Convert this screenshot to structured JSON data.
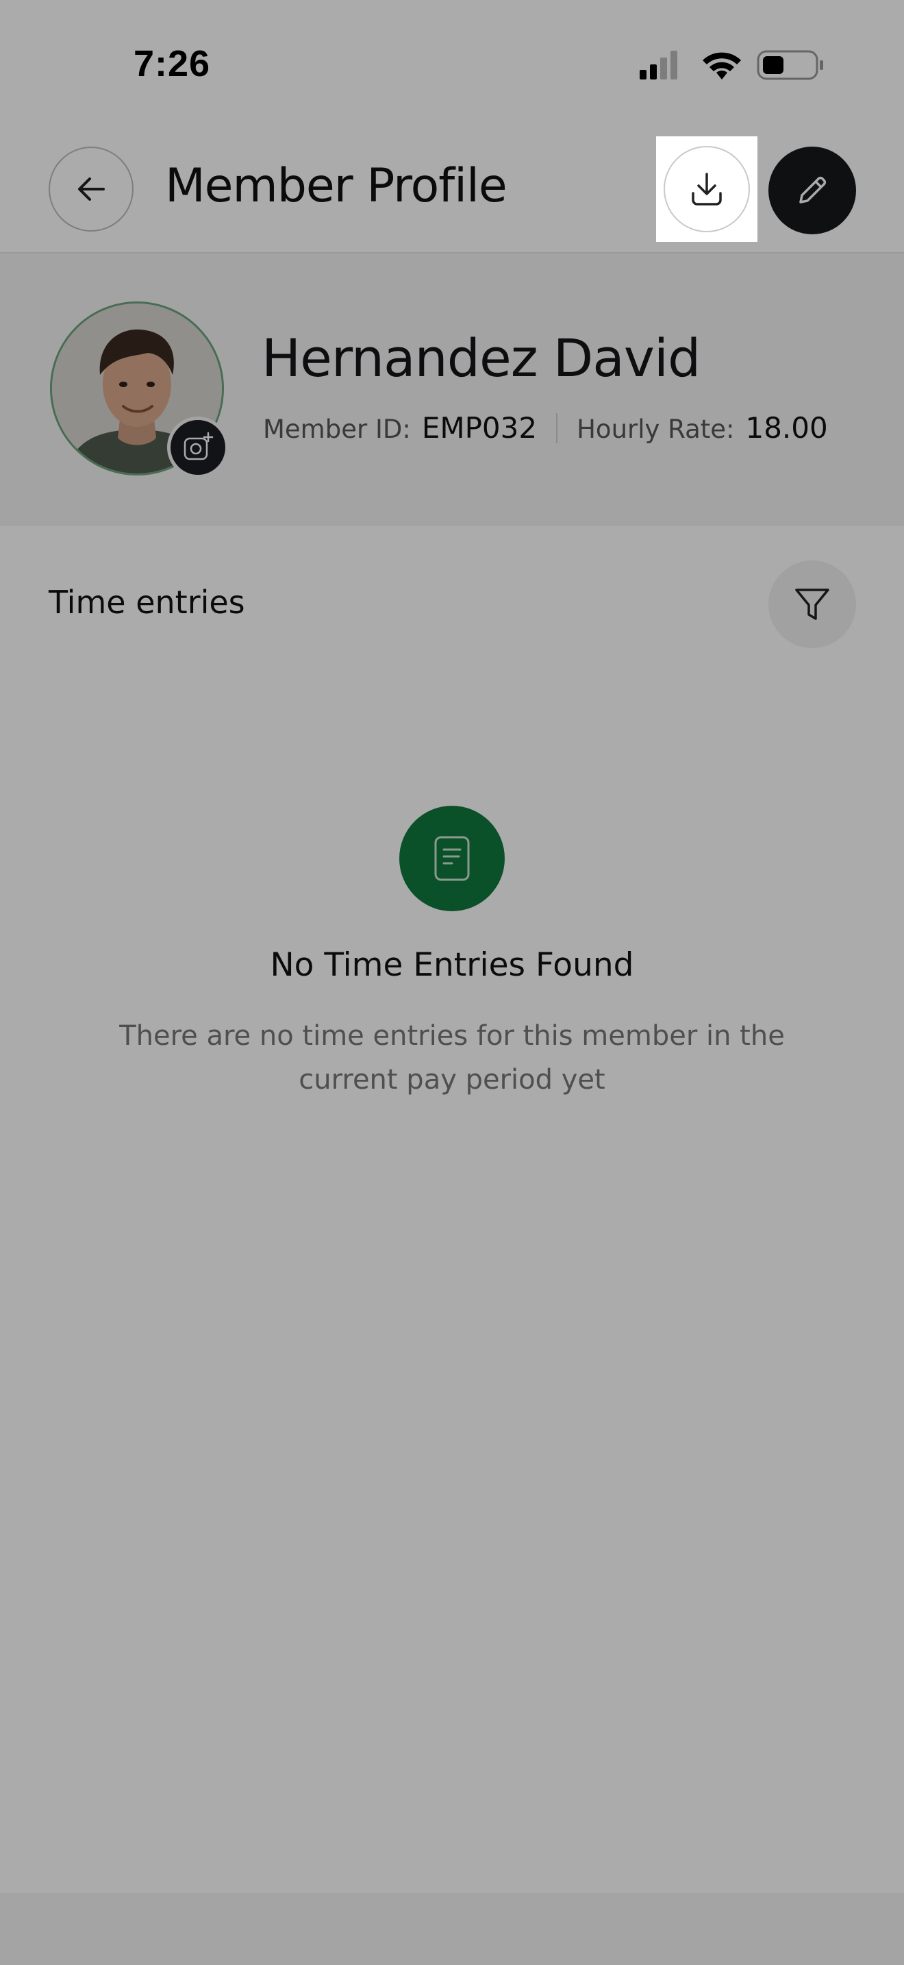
{
  "status_bar": {
    "time": "7:26",
    "signal_icon": "cellular-signal-icon",
    "wifi_icon": "wifi-icon",
    "battery_icon": "battery-icon"
  },
  "header": {
    "title": "Member Profile",
    "back_icon": "arrow-left-icon",
    "download_icon": "download-icon",
    "edit_icon": "pencil-icon"
  },
  "profile": {
    "name": "Hernandez David",
    "member_id_label": "Member ID:",
    "member_id": "EMP032",
    "hourly_rate_label": "Hourly Rate:",
    "hourly_rate": "18.00",
    "camera_icon": "camera-plus-icon"
  },
  "time_entries": {
    "title": "Time entries",
    "filter_icon": "filter-icon",
    "empty_icon": "document-icon",
    "empty_title": "No Time Entries Found",
    "empty_description": "There are no time entries for this member in the current pay period yet"
  },
  "colors": {
    "accent_green": "#0f7a3e",
    "dark_button": "#17181c",
    "avatar_ring": "#6aa37c"
  }
}
